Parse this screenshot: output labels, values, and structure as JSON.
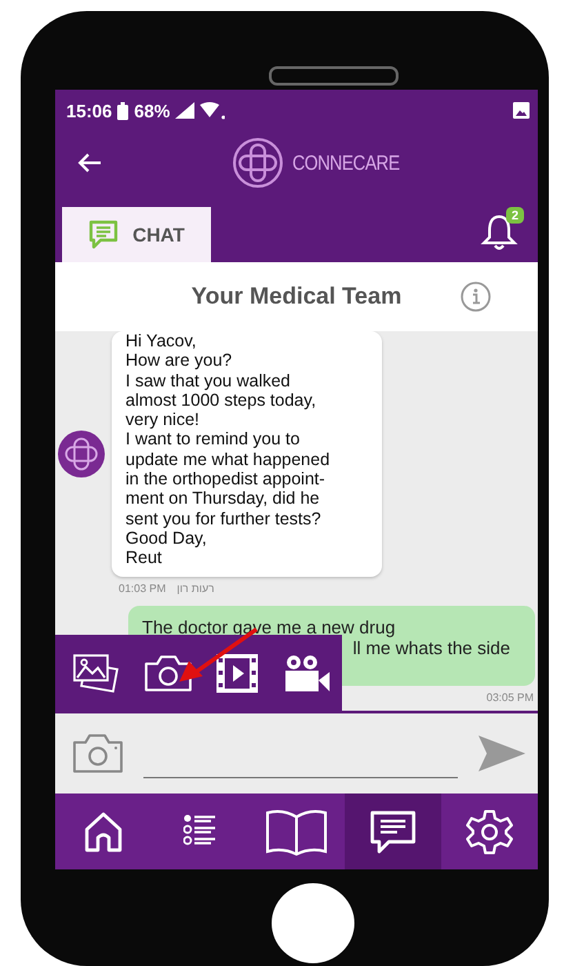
{
  "status_bar": {
    "time": "15:06",
    "battery": "68%"
  },
  "header": {
    "title": "CONNECARE"
  },
  "tabs": [
    {
      "label": "CHAT",
      "selected": true
    }
  ],
  "notifications": {
    "badge": "2"
  },
  "chat": {
    "title": "Your Medical Team",
    "messages": [
      {
        "kind": "incoming",
        "text": "Hi Yacov,\nHow are you?\nI saw that you walked\nalmost 1000 steps today,\nvery nice!\nI want to remind you to\nupdate me what happened\nin the orthopedist appoint-\nment on Thursday, did he\nsent you for further tests?\nGood Day,\nReut",
        "time": "01:03 PM",
        "sender": "רעות רון"
      },
      {
        "kind": "outgoing",
        "text": "The doctor gave me a new drug",
        "hidden_text": "ll me whats the side",
        "time": "03:05 PM"
      }
    ]
  },
  "nav": [
    {
      "kind": "home",
      "selected": false
    },
    {
      "kind": "list",
      "selected": false
    },
    {
      "kind": "book",
      "selected": false
    },
    {
      "kind": "chat",
      "selected": true
    },
    {
      "kind": "settings",
      "selected": false
    }
  ]
}
